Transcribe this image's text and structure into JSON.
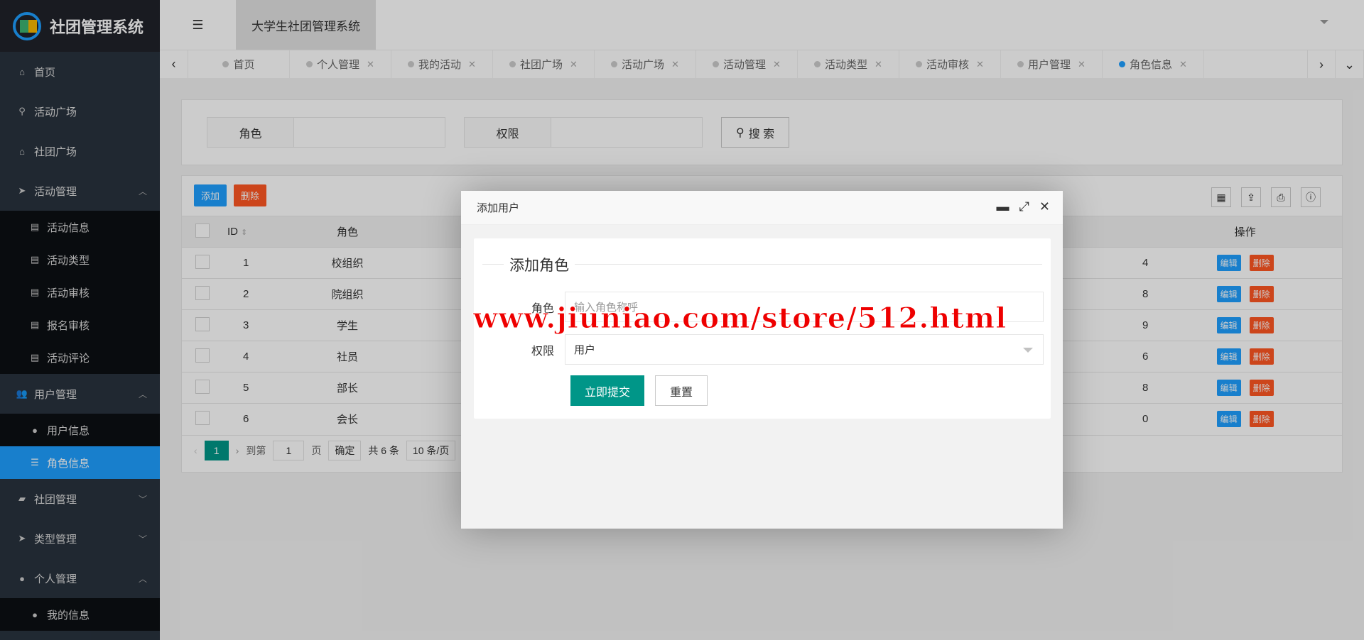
{
  "app": {
    "logo_text": "社团管理系统",
    "header_title": "大学生社团管理系统"
  },
  "sidebar": {
    "home": "首页",
    "activity_square": "活动广场",
    "club_square": "社团广场",
    "activity_mgmt": "活动管理",
    "activity_sub": [
      "活动信息",
      "活动类型",
      "活动审核",
      "报名审核",
      "活动评论"
    ],
    "user_mgmt": "用户管理",
    "user_sub": [
      "用户信息",
      "角色信息"
    ],
    "club_mgmt": "社团管理",
    "type_mgmt": "类型管理",
    "personal_mgmt": "个人管理",
    "personal_sub": [
      "我的信息"
    ]
  },
  "tabs": [
    "首页",
    "个人管理",
    "我的活动",
    "社团广场",
    "活动广场",
    "活动管理",
    "活动类型",
    "活动审核",
    "用户管理",
    "角色信息"
  ],
  "search": {
    "role_label": "角色",
    "perm_label": "权限",
    "button": "搜 索"
  },
  "toolbar": {
    "add": "添加",
    "delete": "删除"
  },
  "table": {
    "headers": {
      "id": "ID",
      "role": "角色",
      "ops": "操作"
    },
    "rows": [
      {
        "id": "1",
        "role": "校组织",
        "extra": "4"
      },
      {
        "id": "2",
        "role": "院组织",
        "extra": "8"
      },
      {
        "id": "3",
        "role": "学生",
        "extra": "9"
      },
      {
        "id": "4",
        "role": "社员",
        "extra": "6"
      },
      {
        "id": "5",
        "role": "部长",
        "extra": "8"
      },
      {
        "id": "6",
        "role": "会长",
        "extra": "0"
      }
    ],
    "edit": "编辑",
    "del": "删除"
  },
  "pager": {
    "current": "1",
    "goto": "到第",
    "page_input": "1",
    "page": "页",
    "confirm": "确定",
    "total": "共 6 条",
    "per_page": "10 条/页"
  },
  "modal": {
    "title": "添加用户",
    "legend": "添加角色",
    "role_label": "角色",
    "role_placeholder": "输入角色称呼",
    "perm_label": "权限",
    "perm_value": "用户",
    "submit": "立即提交",
    "reset": "重置"
  },
  "watermark": "www.jiuniao.com/store/512.html"
}
